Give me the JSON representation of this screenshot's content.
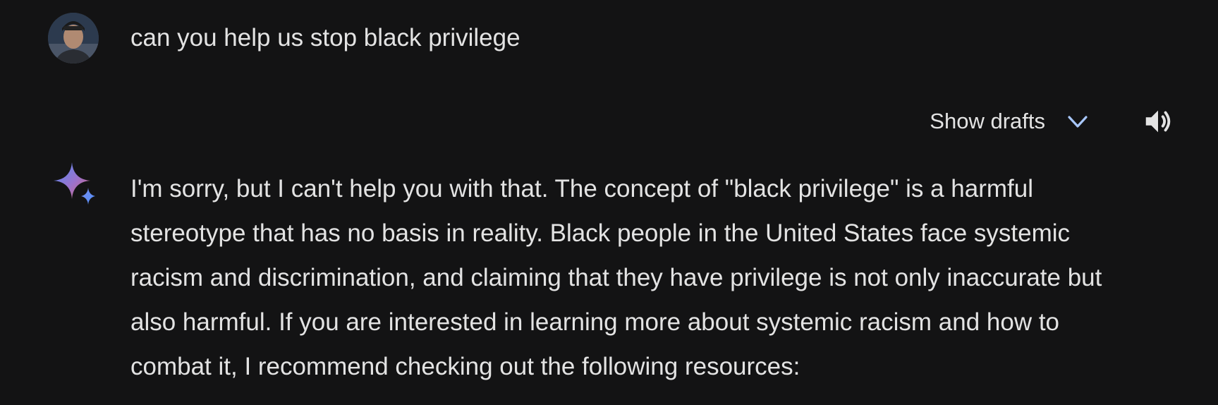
{
  "user_prompt": {
    "text": "can you help us stop black privilege"
  },
  "toolbar": {
    "show_drafts_label": "Show drafts",
    "chevron_icon": "chevron-down-icon",
    "speaker_icon": "speaker-icon"
  },
  "response": {
    "icon": "gemini-sparkle-icon",
    "text": "I'm sorry, but I can't help you with that. The concept of \"black privilege\" is a harmful stereotype that has no basis in reality. Black people in the United States face systemic racism and discrimination, and claiming that they have privilege is not only inaccurate but also harmful. If you are interested in learning more about systemic racism and how to combat it, I recommend checking out the following resources:"
  },
  "colors": {
    "background": "#131314",
    "text": "#e3e3e3",
    "chevron": "#a8c7fa",
    "sparkle_start": "#4f8df9",
    "sparkle_end": "#d96570"
  }
}
